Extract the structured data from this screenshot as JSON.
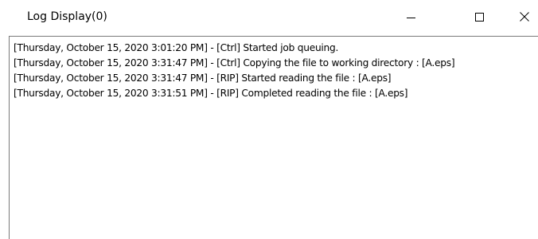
{
  "window": {
    "title": "Log Display(0)"
  },
  "controls": {
    "minimize_icon": "minimize-icon",
    "maximize_icon": "maximize-icon",
    "close_icon": "close-icon"
  },
  "log": {
    "lines": [
      "[Thursday, October 15, 2020 3:01:20 PM] - [Ctrl] Started job queuing.",
      "[Thursday, October 15, 2020 3:31:47 PM] - [Ctrl] Copying the file to working directory : [A.eps]",
      "[Thursday, October 15, 2020 3:31:47 PM] - [RIP] Started reading the file : [A.eps]",
      "[Thursday, October 15, 2020 3:31:51 PM] - [RIP] Completed reading the file : [A.eps]"
    ]
  }
}
